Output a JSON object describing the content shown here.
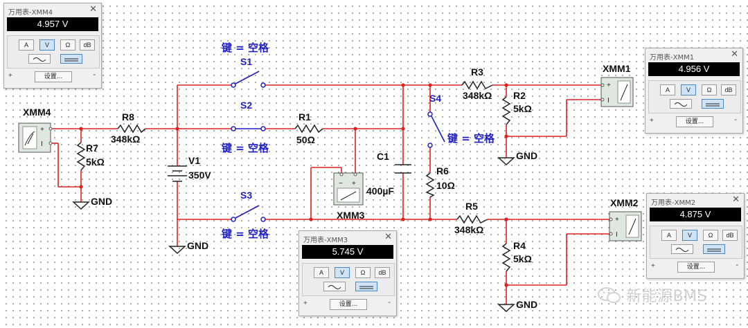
{
  "components": {
    "S1": "S1",
    "S2": "S2",
    "S3": "S3",
    "S4": "S4",
    "key_label": "键 = 空格",
    "R1": "R1",
    "R1_val": "50Ω",
    "R2": "R2",
    "R2_val": "5kΩ",
    "R3": "R3",
    "R3_val": "348kΩ",
    "R4": "R4",
    "R4_val": "5kΩ",
    "R5": "R5",
    "R5_val": "348kΩ",
    "R6": "R6",
    "R6_val": "10Ω",
    "R7": "R7",
    "R7_val": "5kΩ",
    "R8": "R8",
    "R8_val": "348kΩ",
    "C1": "C1",
    "C1_val": "400µF",
    "V1": "V1",
    "V1_val": "350V",
    "gnd": "GND",
    "XMM1": "XMM1",
    "XMM2": "XMM2",
    "XMM3": "XMM3",
    "XMM4": "XMM4"
  },
  "meter_buttons": {
    "a": "A",
    "v": "V",
    "ohm": "Ω",
    "db": "dB",
    "settings": "设置...",
    "plus": "+",
    "minus": "-"
  },
  "meters": [
    {
      "title": "万用表-XMM4",
      "reading": "4.957 V"
    },
    {
      "title": "万用表-XMM1",
      "reading": "4.956 V"
    },
    {
      "title": "万用表-XMM2",
      "reading": "4.875 V"
    },
    {
      "title": "万用表-XMM3",
      "reading": "5.745 V"
    }
  ],
  "close_glyph": "✕",
  "watermark": "新能源BMS",
  "colors": {
    "wire": "#e02020",
    "switch_label": "#1e1ec8",
    "meter_display": "#000000",
    "meter_active": "#cfe3f7"
  }
}
